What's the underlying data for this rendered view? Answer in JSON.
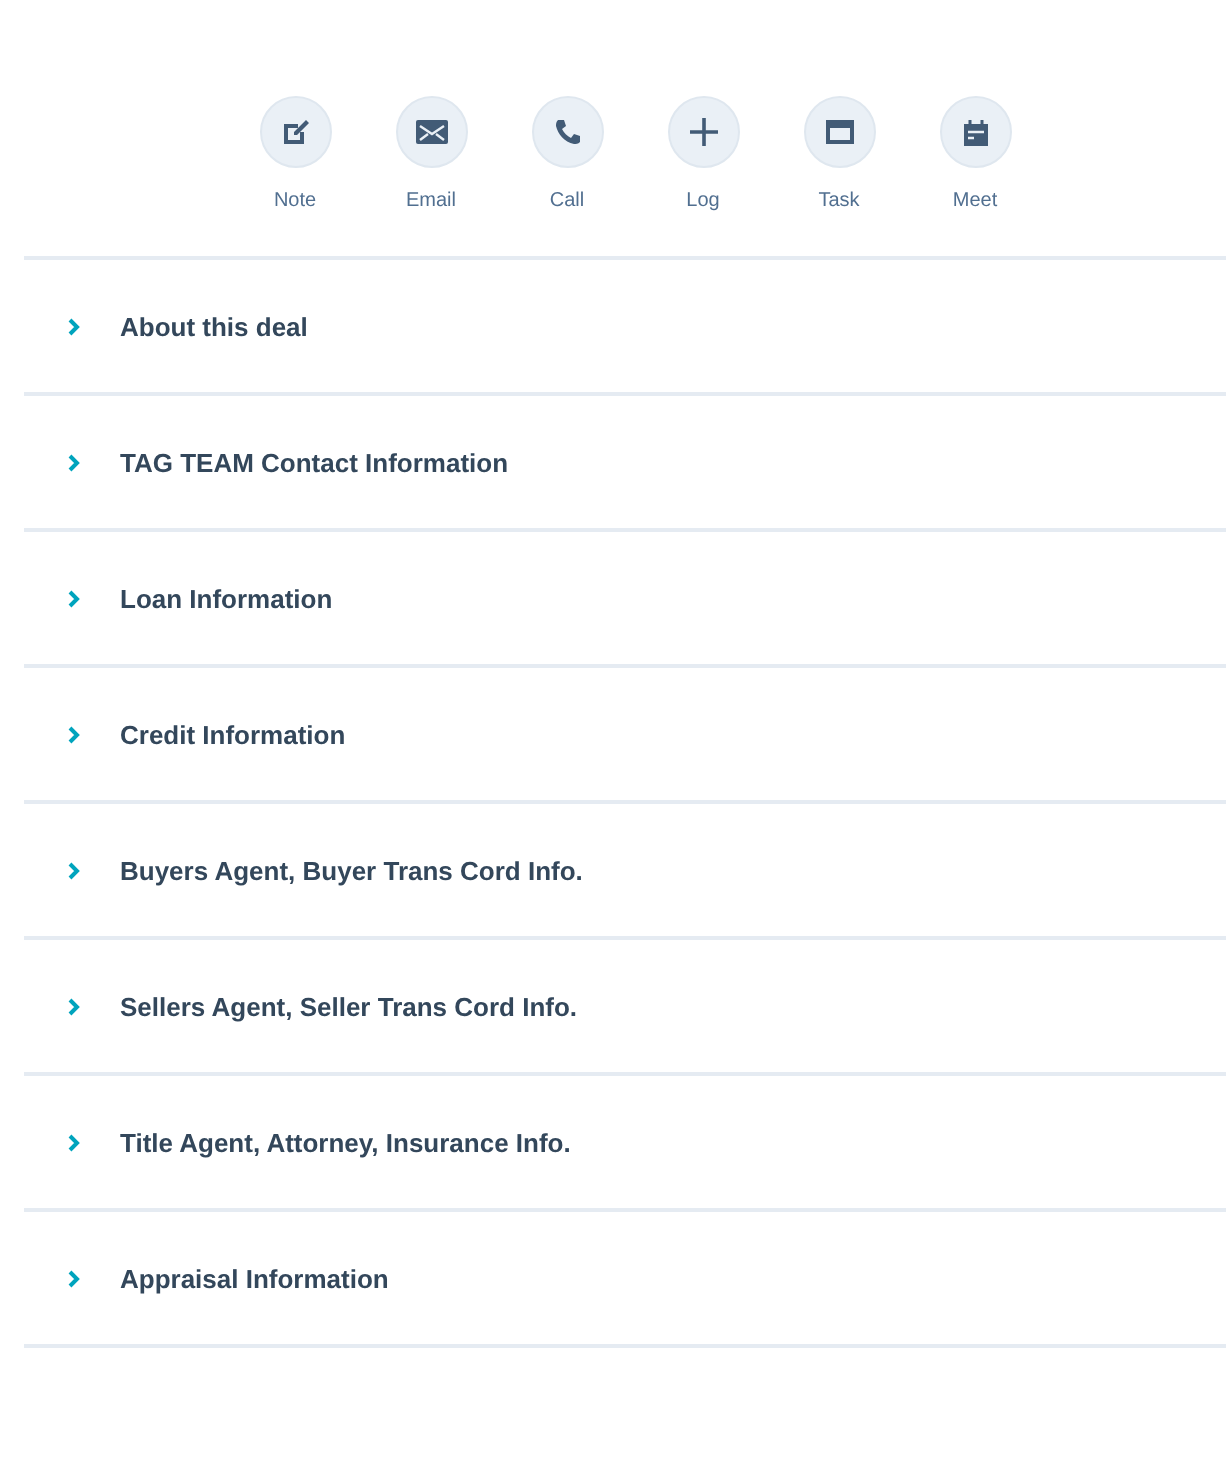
{
  "actions": [
    {
      "kind": "note",
      "label": "Note"
    },
    {
      "kind": "email",
      "label": "Email"
    },
    {
      "kind": "call",
      "label": "Call"
    },
    {
      "kind": "log",
      "label": "Log"
    },
    {
      "kind": "task",
      "label": "Task"
    },
    {
      "kind": "meet",
      "label": "Meet"
    }
  ],
  "sections": [
    {
      "title": "About this deal",
      "expanded": false
    },
    {
      "title": "TAG TEAM Contact Information",
      "expanded": false
    },
    {
      "title": "Loan Information",
      "expanded": false
    },
    {
      "title": "Credit Information",
      "expanded": false
    },
    {
      "title": "Buyers Agent, Buyer Trans Cord Info.",
      "expanded": false
    },
    {
      "title": "Sellers Agent, Seller Trans Cord Info.",
      "expanded": false
    },
    {
      "title": "Title Agent, Attorney, Insurance Info.",
      "expanded": false
    },
    {
      "title": "Appraisal Information",
      "expanded": false
    }
  ]
}
